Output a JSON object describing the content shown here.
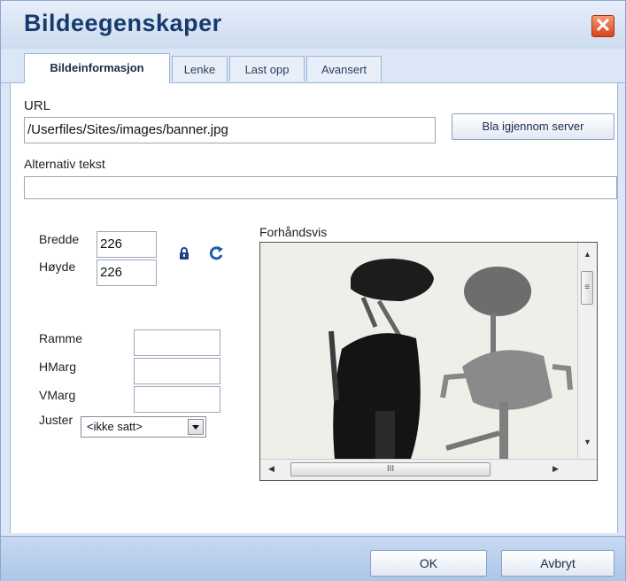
{
  "dialog": {
    "title": "Bildeegenskaper",
    "close_glyph": "✕"
  },
  "tabs": [
    {
      "label": "Bildeinformasjon",
      "active": true
    },
    {
      "label": "Lenke"
    },
    {
      "label": "Last opp"
    },
    {
      "label": "Avansert"
    }
  ],
  "url": {
    "label": "URL",
    "value": "/Userfiles/Sites/images/banner.jpg",
    "browse_label": "Bla igjennom server"
  },
  "alt": {
    "label": "Alternativ tekst",
    "value": ""
  },
  "size": {
    "width_label": "Bredde",
    "width_value": "226",
    "height_label": "Høyde",
    "height_value": "226",
    "lock_icon": "lock-icon",
    "reset_icon": "reset-size-icon"
  },
  "layout": {
    "border_label": "Ramme",
    "border_value": "",
    "hspace_label": "HMarg",
    "hspace_value": "",
    "vspace_label": "VMarg",
    "vspace_value": "",
    "align_label": "Juster",
    "align_value": "<ikke satt>"
  },
  "preview": {
    "label": "Forhåndsvis",
    "h_thumb_glyph": "III",
    "v_thumb_glyph": "≡"
  },
  "footer": {
    "ok_label": "OK",
    "cancel_label": "Avbryt"
  },
  "colors": {
    "title": "#163a6e",
    "accent": "#8aa7cf",
    "close": "#d9421c"
  }
}
